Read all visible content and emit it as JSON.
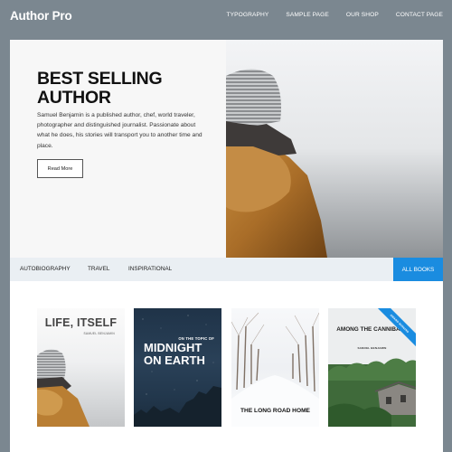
{
  "site": {
    "title": "Author Pro"
  },
  "nav": {
    "items": [
      {
        "label": "TYPOGRAPHY"
      },
      {
        "label": "SAMPLE PAGE"
      },
      {
        "label": "OUR SHOP"
      },
      {
        "label": "CONTACT PAGE"
      }
    ]
  },
  "hero": {
    "title": "BEST SELLING AUTHOR",
    "description": "Samuel Benjamin is a published author, chef, world traveler, photographer and distinguished journalist. Passionate about what he does, his stories will transport you to another time and place.",
    "button_label": "Read More"
  },
  "categories": {
    "items": [
      {
        "label": "AUTOBIOGRAPHY"
      },
      {
        "label": "TRAVEL"
      },
      {
        "label": "INSPIRATIONAL"
      }
    ],
    "all_label": "ALL BOOKS"
  },
  "books": [
    {
      "title": "LIFE, ITSELF",
      "author": "SAMUEL BENJAMIN"
    },
    {
      "kicker": "ON THE TOPIC OF",
      "title": "MIDNIGHT ON EARTH"
    },
    {
      "title": "THE LONG ROAD HOME"
    },
    {
      "title": "AMONG THE CANNIBALS",
      "author": "SAMUEL BENJAMIN",
      "ribbon": "AWARD WINNING"
    }
  ],
  "colors": {
    "header_bg": "#7b8790",
    "accent": "#1a8ce0",
    "category_bar_bg": "#eaeff3",
    "hero_text_bg": "#f7f7f7"
  }
}
